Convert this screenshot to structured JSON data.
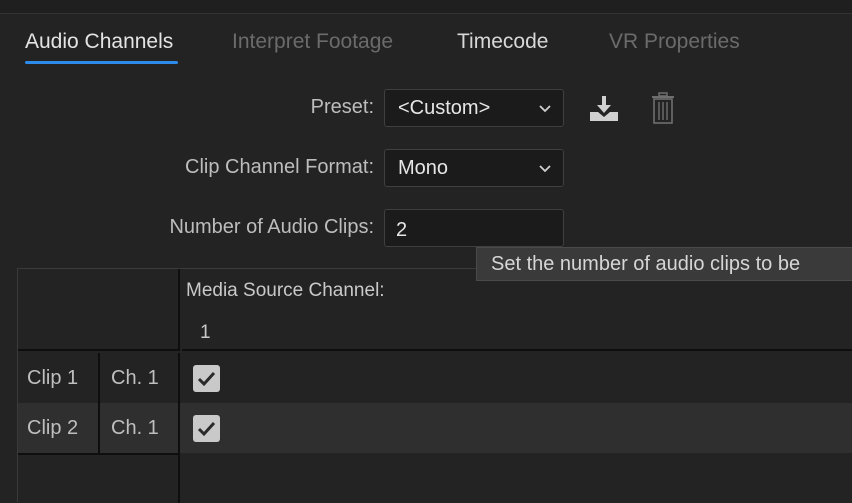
{
  "tabs": [
    {
      "label": "Audio Channels",
      "state": "active"
    },
    {
      "label": "Interpret Footage",
      "state": "disabled"
    },
    {
      "label": "Timecode",
      "state": "normal"
    },
    {
      "label": "VR Properties",
      "state": "disabled"
    }
  ],
  "form": {
    "preset_label": "Preset:",
    "preset_value": "<Custom>",
    "clip_format_label": "Clip Channel Format:",
    "clip_format_value": "Mono",
    "num_clips_label": "Number of Audio Clips:",
    "num_clips_value": "2"
  },
  "tooltip": "Set the number of audio clips to be",
  "grid": {
    "header_title": "Media Source Channel:",
    "columns": [
      "1"
    ],
    "rows": [
      {
        "clip": "Clip 1",
        "channel": "Ch. 1",
        "checked": true
      },
      {
        "clip": "Clip 2",
        "channel": "Ch. 1",
        "checked": true
      }
    ]
  },
  "icons": {
    "save_preset": "save-preset-icon",
    "delete_preset": "trash-icon",
    "dropdown": "chevron-down-icon",
    "check": "checkmark-icon"
  },
  "colors": {
    "accent": "#2d8ceb",
    "background": "#232323"
  }
}
